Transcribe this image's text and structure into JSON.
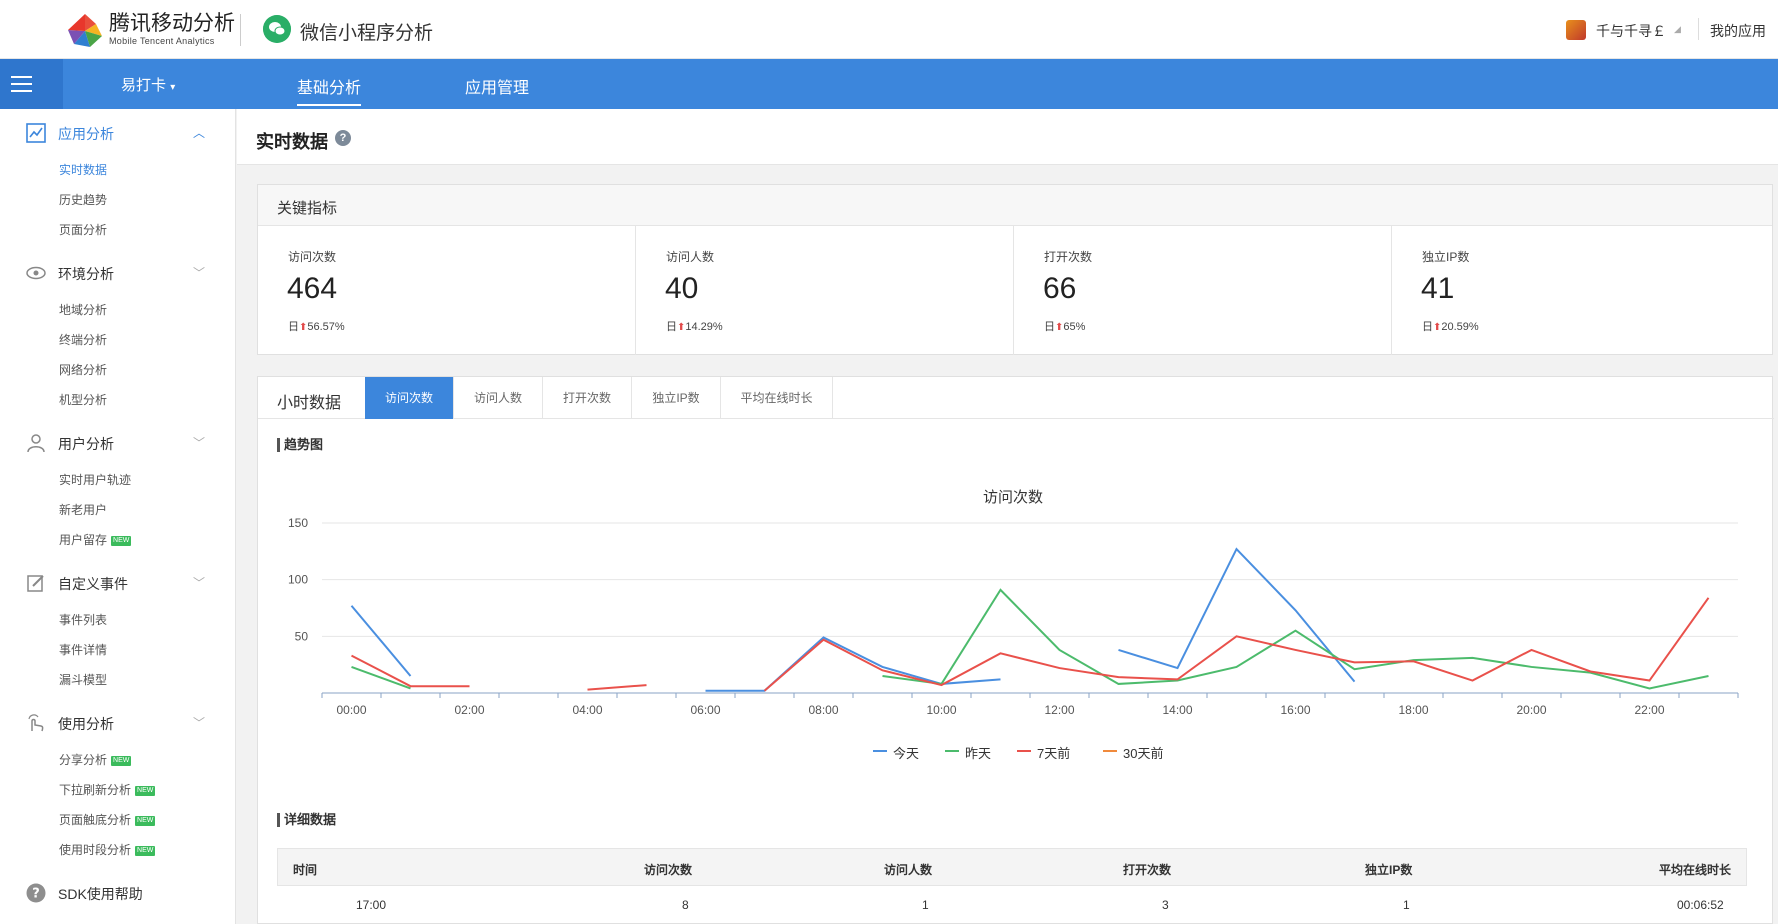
{
  "header": {
    "brand_title": "腾讯移动分析",
    "brand_subtitle": "Mobile Tencent Analytics",
    "product_title": "微信小程序分析",
    "user_name": "千与千寻￡",
    "my_apps": "我的应用"
  },
  "nav": {
    "app_name": "易打卡",
    "tabs": [
      "基础分析",
      "应用管理"
    ]
  },
  "sidebar": {
    "sections": [
      {
        "label": "应用分析",
        "icon": "trend-chart-icon",
        "items": [
          {
            "label": "实时数据",
            "active": true,
            "new": false
          },
          {
            "label": "历史趋势",
            "active": false,
            "new": false
          },
          {
            "label": "页面分析",
            "active": false,
            "new": false
          }
        ]
      },
      {
        "label": "环境分析",
        "icon": "eye-icon",
        "items": [
          {
            "label": "地域分析",
            "new": false
          },
          {
            "label": "终端分析",
            "new": false
          },
          {
            "label": "网络分析",
            "new": false
          },
          {
            "label": "机型分析",
            "new": false
          }
        ]
      },
      {
        "label": "用户分析",
        "icon": "user-icon",
        "items": [
          {
            "label": "实时用户轨迹",
            "new": false
          },
          {
            "label": "新老用户",
            "new": false
          },
          {
            "label": "用户留存",
            "new": true
          }
        ]
      },
      {
        "label": "自定义事件",
        "icon": "edit-icon",
        "items": [
          {
            "label": "事件列表",
            "new": false
          },
          {
            "label": "事件详情",
            "new": false
          },
          {
            "label": "漏斗模型",
            "new": false
          }
        ]
      },
      {
        "label": "使用分析",
        "icon": "touch-icon",
        "items": [
          {
            "label": "分享分析",
            "new": true
          },
          {
            "label": "下拉刷新分析",
            "new": true
          },
          {
            "label": "页面触底分析",
            "new": true
          },
          {
            "label": "使用时段分析",
            "new": true
          }
        ]
      }
    ],
    "help": "SDK使用帮助",
    "new_badge": "NEW"
  },
  "page": {
    "title": "实时数据",
    "help_mark": "?"
  },
  "kpi": {
    "title": "关键指标",
    "items": [
      {
        "label": "访问次数",
        "value": "464",
        "prefix": "日",
        "change": "56.57%"
      },
      {
        "label": "访问人数",
        "value": "40",
        "prefix": "日",
        "change": "14.29%"
      },
      {
        "label": "打开次数",
        "value": "66",
        "prefix": "日",
        "change": "65%"
      },
      {
        "label": "独立IP数",
        "value": "41",
        "prefix": "日",
        "change": "20.59%"
      }
    ]
  },
  "hourly": {
    "title": "小时数据",
    "tabs": [
      "访问次数",
      "访问人数",
      "打开次数",
      "独立IP数",
      "平均在线时长"
    ],
    "trend_label": "趋势图",
    "detail_label": "详细数据"
  },
  "chart_data": {
    "type": "line",
    "title": "访问次数",
    "x": [
      "00:00",
      "01:00",
      "02:00",
      "03:00",
      "04:00",
      "05:00",
      "06:00",
      "07:00",
      "08:00",
      "09:00",
      "10:00",
      "11:00",
      "12:00",
      "13:00",
      "14:00",
      "15:00",
      "16:00",
      "17:00",
      "18:00",
      "19:00",
      "20:00",
      "21:00",
      "22:00",
      "23:00"
    ],
    "xticks": [
      "00:00",
      "02:00",
      "04:00",
      "06:00",
      "08:00",
      "10:00",
      "12:00",
      "14:00",
      "16:00",
      "18:00",
      "20:00",
      "22:00"
    ],
    "yticks": [
      50,
      100,
      150
    ],
    "ylim": [
      0,
      150
    ],
    "series": [
      {
        "name": "今天",
        "color": "#4a8fe0",
        "values": [
          77,
          15,
          null,
          null,
          null,
          null,
          2,
          2,
          49,
          23,
          8,
          12,
          null,
          38,
          22,
          127,
          73,
          10,
          null,
          null,
          null,
          null,
          null,
          null
        ]
      },
      {
        "name": "昨天",
        "color": "#4cbb6c",
        "values": [
          23,
          4,
          null,
          null,
          null,
          null,
          null,
          null,
          null,
          15,
          8,
          91,
          38,
          8,
          11,
          23,
          55,
          21,
          29,
          31,
          23,
          18,
          4,
          15
        ]
      },
      {
        "name": "7天前",
        "color": "#e9514b",
        "values": [
          33,
          6,
          6,
          null,
          3,
          7,
          null,
          2,
          47,
          20,
          7,
          35,
          22,
          14,
          12,
          50,
          38,
          27,
          28,
          11,
          38,
          19,
          11,
          84
        ]
      },
      {
        "name": "30天前",
        "color": "#f08a3c",
        "values": []
      }
    ],
    "legend": "bottom"
  },
  "table": {
    "headers": [
      "时间",
      "访问次数",
      "访问人数",
      "打开次数",
      "独立IP数",
      "平均在线时长"
    ],
    "rows": [
      [
        "17:00",
        "8",
        "1",
        "3",
        "1",
        "00:06:52"
      ]
    ]
  }
}
